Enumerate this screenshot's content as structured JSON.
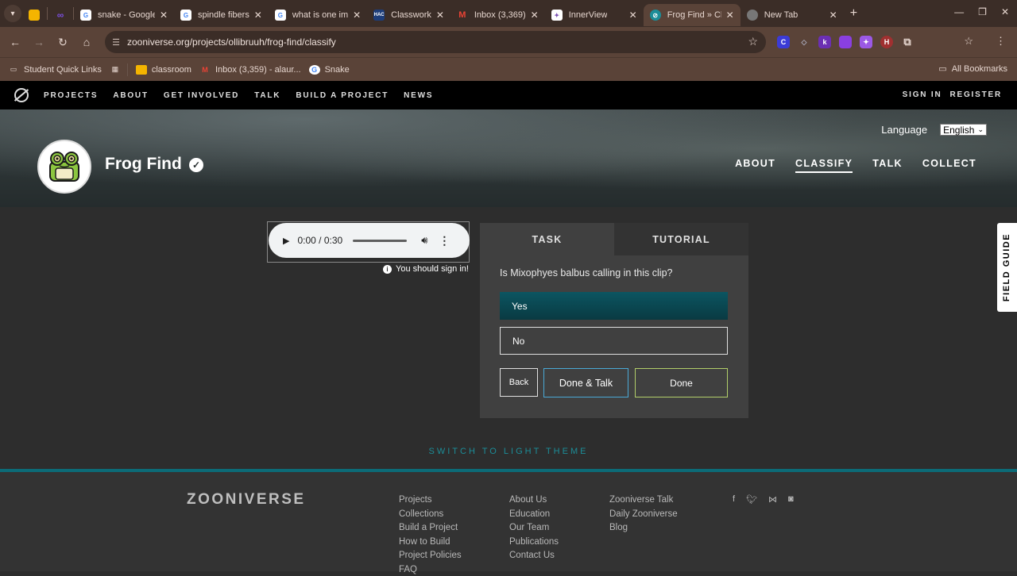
{
  "browser": {
    "tabs": [
      {
        "title": "",
        "favicon": "slides-icon",
        "color": "#f4b400",
        "pinned": true
      },
      {
        "title": "",
        "favicon": "pinned-purple-icon",
        "color": "#6a3fd6",
        "pinned": true
      },
      {
        "title": "snake - Google",
        "favicon": "google-icon",
        "color": "#4285f4"
      },
      {
        "title": "spindle fibers",
        "favicon": "google-icon",
        "color": "#4285f4"
      },
      {
        "title": "what is one im",
        "favicon": "google-icon",
        "color": "#4285f4"
      },
      {
        "title": "Classwork",
        "favicon": "hac-icon",
        "color": "#1d3d7a",
        "glyph": "HAC"
      },
      {
        "title": "Inbox (3,369)",
        "favicon": "gmail-icon",
        "color": "#d93025",
        "glyph": "M"
      },
      {
        "title": "InnerView",
        "favicon": "innerview-icon",
        "color": "#7a4fb5"
      },
      {
        "title": "Frog Find » Cla",
        "favicon": "zooniverse-icon",
        "color": "#1c8d98",
        "active": true
      },
      {
        "title": "New Tab",
        "favicon": "chrome-icon",
        "color": "#888888"
      }
    ],
    "url": "zooniverse.org/projects/ollibruuh/frog-find/classify",
    "bookmarks": [
      {
        "label": "Student Quick Links",
        "icon": "bookmark-folder-icon"
      },
      {
        "label": "classroom",
        "icon": "classroom-icon"
      },
      {
        "label": "Inbox (3,359) - alaur...",
        "icon": "gmail-icon"
      },
      {
        "label": "Snake",
        "icon": "google-icon"
      }
    ],
    "all_bookmarks": "All Bookmarks"
  },
  "zoo_nav": {
    "links": [
      "PROJECTS",
      "ABOUT",
      "GET INVOLVED",
      "TALK",
      "BUILD A PROJECT",
      "NEWS"
    ],
    "sign_in": "SIGN IN",
    "register": "REGISTER"
  },
  "project": {
    "title": "Frog Find",
    "language_label": "Language",
    "language_value": "English",
    "nav": [
      "ABOUT",
      "CLASSIFY",
      "TALK",
      "COLLECT"
    ],
    "active_nav": "CLASSIFY"
  },
  "audio": {
    "time": "0:00 / 0:30",
    "progress": 0
  },
  "signin_note": "You should sign in!",
  "task": {
    "tab_task": "TASK",
    "tab_tutorial": "TUTORIAL",
    "question": "Is Mixophyes balbus calling in this clip?",
    "answers": [
      "Yes",
      "No"
    ],
    "selected": "Yes",
    "back": "Back",
    "done_talk": "Done & Talk",
    "done": "Done"
  },
  "switch_theme": "SWITCH TO LIGHT THEME",
  "field_guide": "FIELD GUIDE",
  "footer": {
    "logo": "ZOONIVERSE",
    "col1": [
      "Projects",
      "Collections",
      "Build a Project",
      "How to Build",
      "Project Policies",
      "FAQ"
    ],
    "col2": [
      "About Us",
      "Education",
      "Our Team",
      "Publications",
      "Contact Us"
    ],
    "col3": [
      "Zooniverse Talk",
      "Daily Zooniverse",
      "Blog"
    ],
    "social": [
      "facebook-icon",
      "twitter-icon",
      "bluesky-icon",
      "instagram-icon"
    ]
  }
}
